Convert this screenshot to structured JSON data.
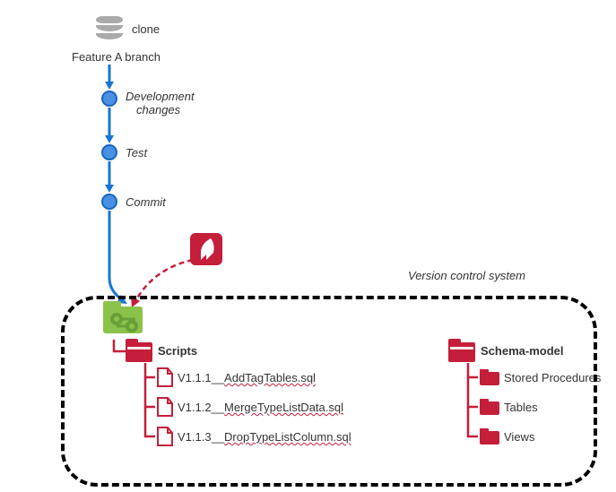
{
  "header": {
    "clone": "clone",
    "branch": "Feature A branch"
  },
  "steps": {
    "dev": "Development changes",
    "test": "Test",
    "commit": "Commit"
  },
  "vcs": {
    "title": "Version control system",
    "scripts": {
      "label": "Scripts",
      "files": [
        "V1.1.1__AddTagTables.sql",
        "V1.1.2__MergeTypeListData.sql",
        "V1.1.3__DropTypeListColumn.sql"
      ]
    },
    "schema": {
      "label": "Schema-model",
      "items": [
        "Stored Procedures",
        "Tables",
        "Views"
      ]
    }
  }
}
